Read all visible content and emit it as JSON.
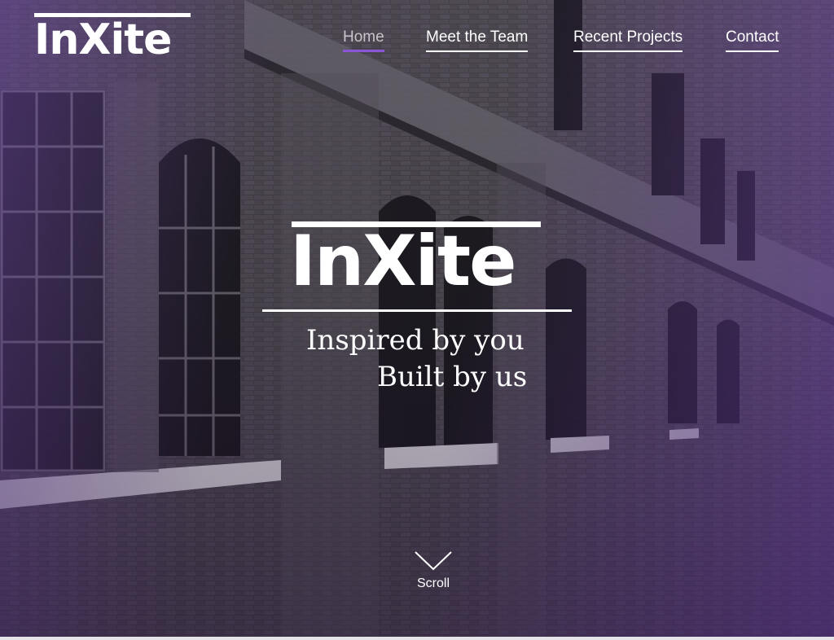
{
  "brand": {
    "name": "InXite"
  },
  "nav": {
    "items": [
      {
        "label": "Home",
        "active": true
      },
      {
        "label": "Meet the Team",
        "active": false
      },
      {
        "label": "Recent Projects",
        "active": false
      },
      {
        "label": "Contact",
        "active": false
      }
    ]
  },
  "hero": {
    "logo_text": "InXite",
    "tagline_line1": "Inspired by you",
    "tagline_line2": "Built by us",
    "background_icon": "brick-building-photo"
  },
  "scroll": {
    "label": "Scroll",
    "icon": "chevron-down-icon"
  },
  "colors": {
    "accent": "#8a55d6",
    "overlay_purple": "#7a48c0",
    "text": "#ffffff"
  }
}
